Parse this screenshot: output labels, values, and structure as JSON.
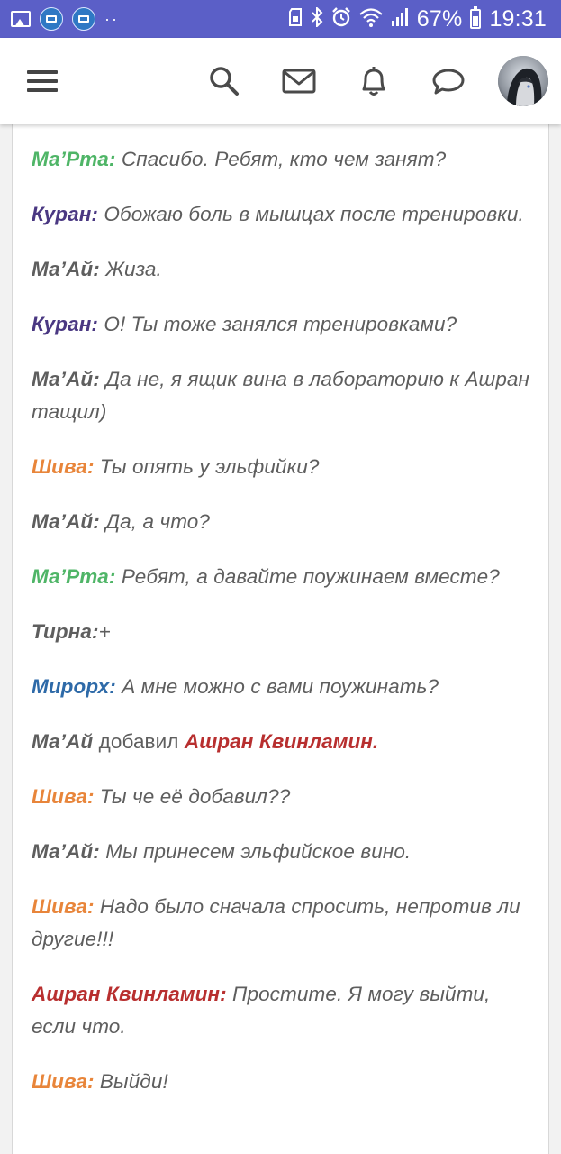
{
  "status_bar": {
    "battery": "67%",
    "time": "19:31",
    "dots": "··"
  },
  "header": {
    "menu_icon": "hamburger-menu-icon",
    "search_icon": "search-icon",
    "mail_icon": "mail-icon",
    "bell_icon": "bell-icon",
    "chat_icon": "chat-bubble-icon",
    "avatar": "user-avatar"
  },
  "colors": {
    "status_bar": "#5b5fc7",
    "green": "#4fb567",
    "purple": "#4a3882",
    "gray": "#5e5e5e",
    "orange": "#e8853a",
    "blue": "#2e6aa8",
    "red": "#b82f2f"
  },
  "messages": [
    {
      "speaker": "Ма’Рта:",
      "text": " Спасибо. Ребят, кто чем занят?"
    },
    {
      "speaker": "Куран:",
      "text": " Обожаю боль в мышцах после тренировки."
    },
    {
      "speaker": "Ма’Ай:",
      "text": " Жиза."
    },
    {
      "speaker": "Куран:",
      "text": " О! Ты тоже занялся тренировками?"
    },
    {
      "speaker": "Ма’Ай:",
      "text": " Да не, я ящик вина в лабораторию к Ашран тащил)"
    },
    {
      "speaker": "Шива:",
      "text": " Ты опять у эльфийки?"
    },
    {
      "speaker": "Ма’Ай:",
      "text": " Да, а что?"
    },
    {
      "speaker": "Ма’Рта:",
      "text": " Ребят, а давайте поужинаем вместе?"
    },
    {
      "speaker": "Тирна:",
      "text": "+"
    },
    {
      "speaker": "Мирорх:",
      "text": " А мне можно с вами поужинать?"
    },
    {
      "speaker": "Ма’Ай",
      "mid": " добавил ",
      "target": "Ашран Квинламин."
    },
    {
      "speaker": "Шива:",
      "text": " Ты че её добавил??"
    },
    {
      "speaker": "Ма’Ай:",
      "text": " Мы принесем эльфийское вино."
    },
    {
      "speaker": "Шива:",
      "text": " Надо было сначала спросить, непротив ли другие!!!"
    },
    {
      "speaker": "Ашран Квинламин:",
      "text": " Простите. Я могу выйти, если что."
    },
    {
      "speaker": "Шива:",
      "text": " Выйди!"
    }
  ]
}
